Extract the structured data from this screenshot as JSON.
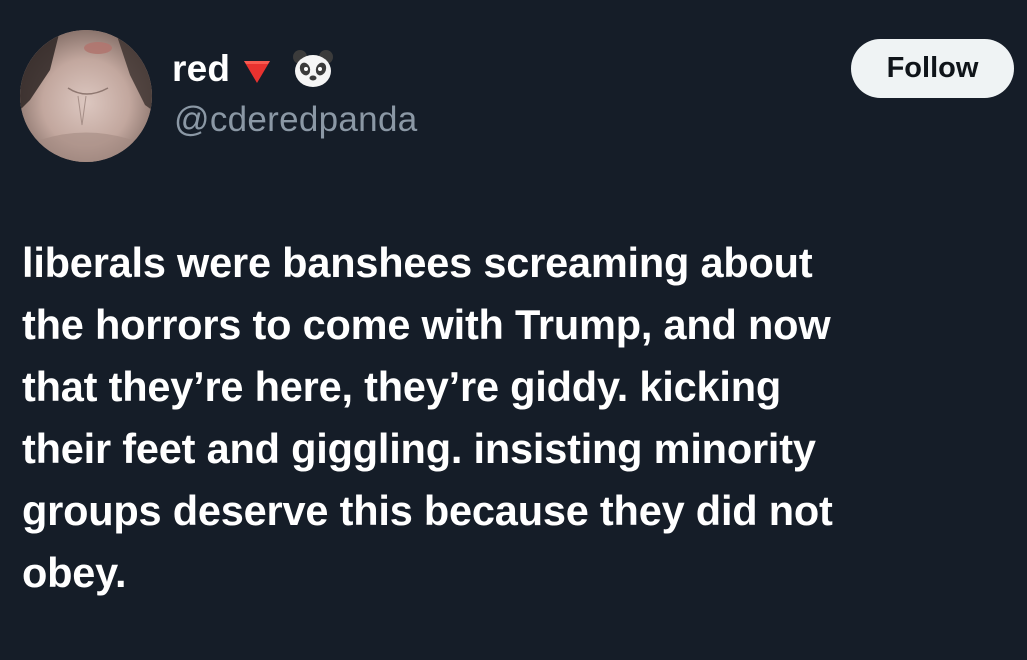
{
  "author": {
    "display_name": "red",
    "name_emojis": [
      "red-triangle-down-icon",
      "panda-face-icon"
    ],
    "handle": "@cderedpanda",
    "avatar": "profile-photo"
  },
  "actions": {
    "follow_label": "Follow"
  },
  "tweet": {
    "lines": [
      "liberals were banshees screaming about",
      "the horrors to come with Trump, and now",
      "that they’re here, they’re giddy. kicking",
      "their feet and giggling. insisting minority",
      "groups deserve this because they did not",
      "obey."
    ]
  },
  "colors": {
    "background": "#151d28",
    "text_primary": "#ffffff",
    "text_secondary": "#8b98a5",
    "follow_bg": "#eff3f4",
    "follow_text": "#0f1419",
    "triangle": "#e8322f"
  }
}
